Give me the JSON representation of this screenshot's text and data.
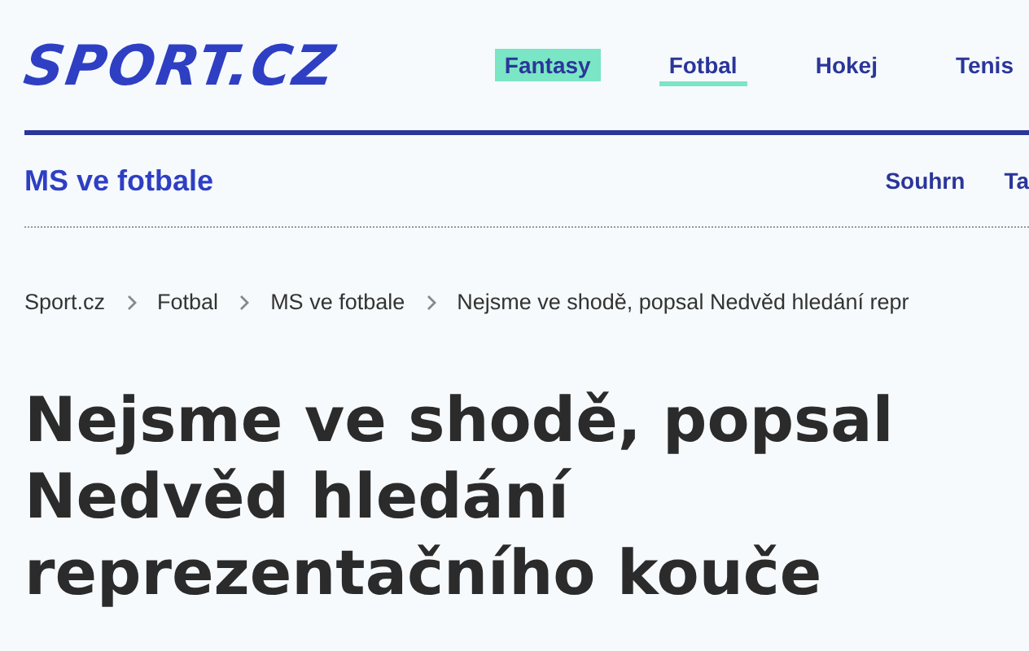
{
  "logo": "SPORT.CZ",
  "nav": [
    {
      "label": "Fantasy",
      "kind": "highlight",
      "selected": false
    },
    {
      "label": "Fotbal",
      "kind": "plain",
      "selected": true
    },
    {
      "label": "Hokej",
      "kind": "plain",
      "selected": false
    },
    {
      "label": "Tenis",
      "kind": "plain",
      "selected": false
    }
  ],
  "section": {
    "title": "MS ve fotbale",
    "links": [
      "Souhrn",
      "Ta"
    ]
  },
  "breadcrumb": [
    "Sport.cz",
    "Fotbal",
    "MS ve fotbale",
    "Nejsme ve shodě, popsal Nedvěd hledání repr"
  ],
  "headline": "Nejsme ve shodě, popsal Nedvěd hledání reprezentačního kouče"
}
